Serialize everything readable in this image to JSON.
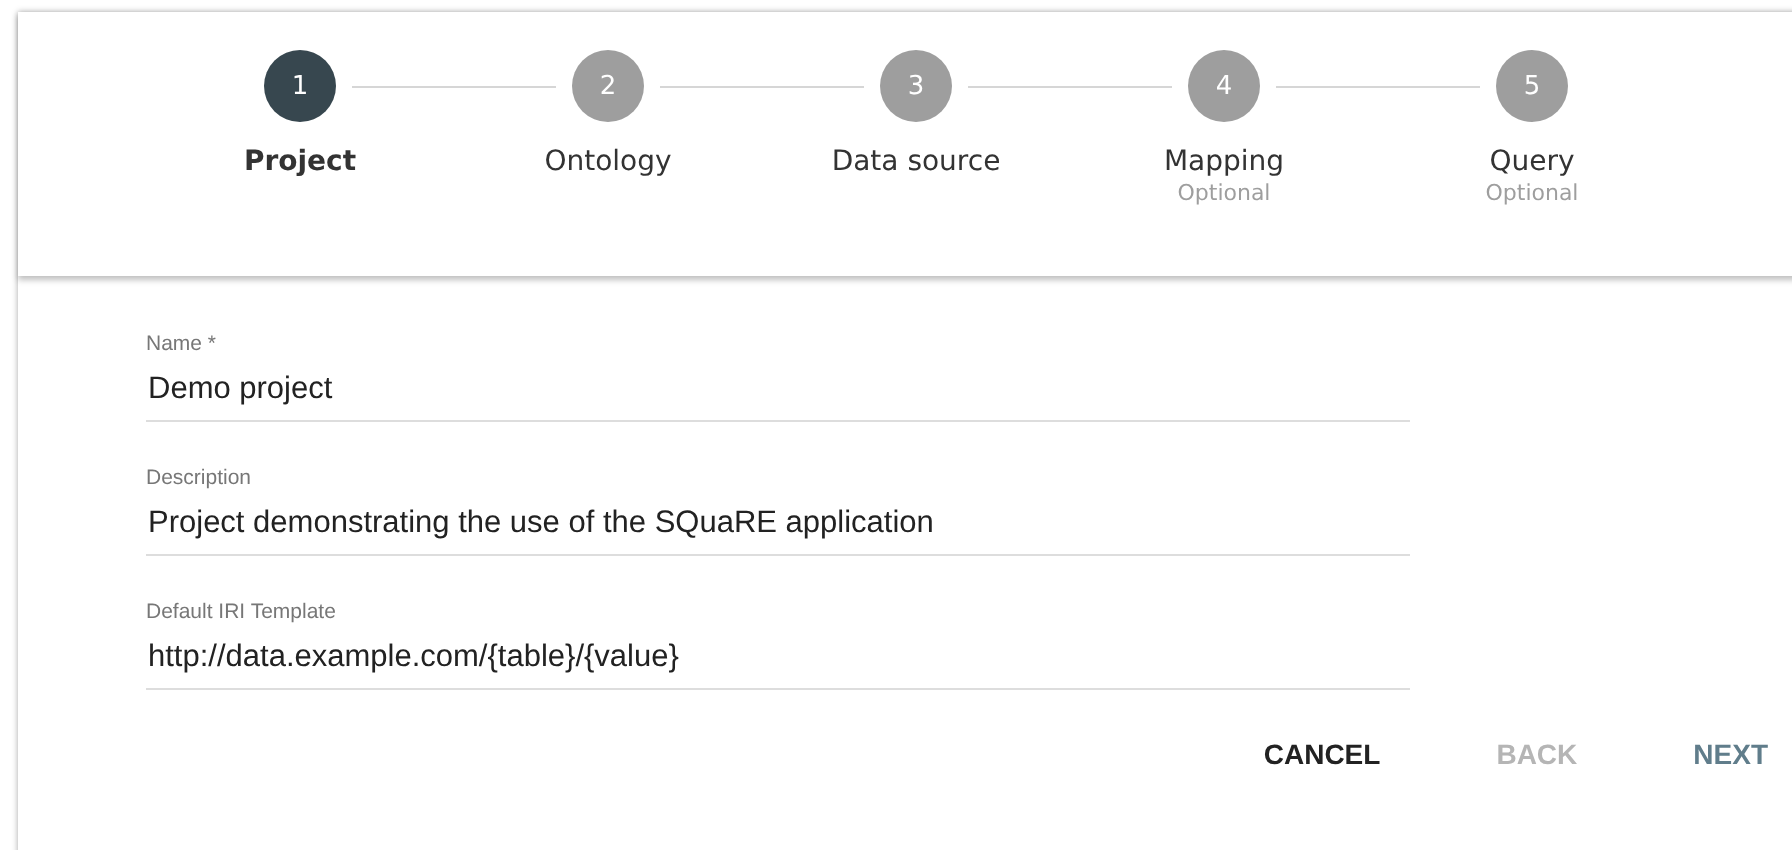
{
  "stepper": {
    "steps": [
      {
        "number": "1",
        "label": "Project",
        "selected": true
      },
      {
        "number": "2",
        "label": "Ontology",
        "selected": false
      },
      {
        "number": "3",
        "label": "Data source",
        "selected": false
      },
      {
        "number": "4",
        "label": "Mapping",
        "hint": "Optional",
        "selected": false
      },
      {
        "number": "5",
        "label": "Query",
        "hint": "Optional",
        "selected": false
      }
    ]
  },
  "form": {
    "fields": [
      {
        "label": "Name *",
        "value": "Demo project"
      },
      {
        "label": "Description",
        "value": "Project demonstrating the use of the SQuaRE application"
      },
      {
        "label": "Default IRI Template",
        "value": "http://data.example.com/{table}/{value}"
      }
    ]
  },
  "buttons": [
    {
      "label": "CANCEL",
      "kind": "cancel",
      "disabled": false
    },
    {
      "label": "BACK",
      "kind": "back",
      "disabled": true
    },
    {
      "label": "NEXT",
      "kind": "next",
      "disabled": false
    }
  ]
}
